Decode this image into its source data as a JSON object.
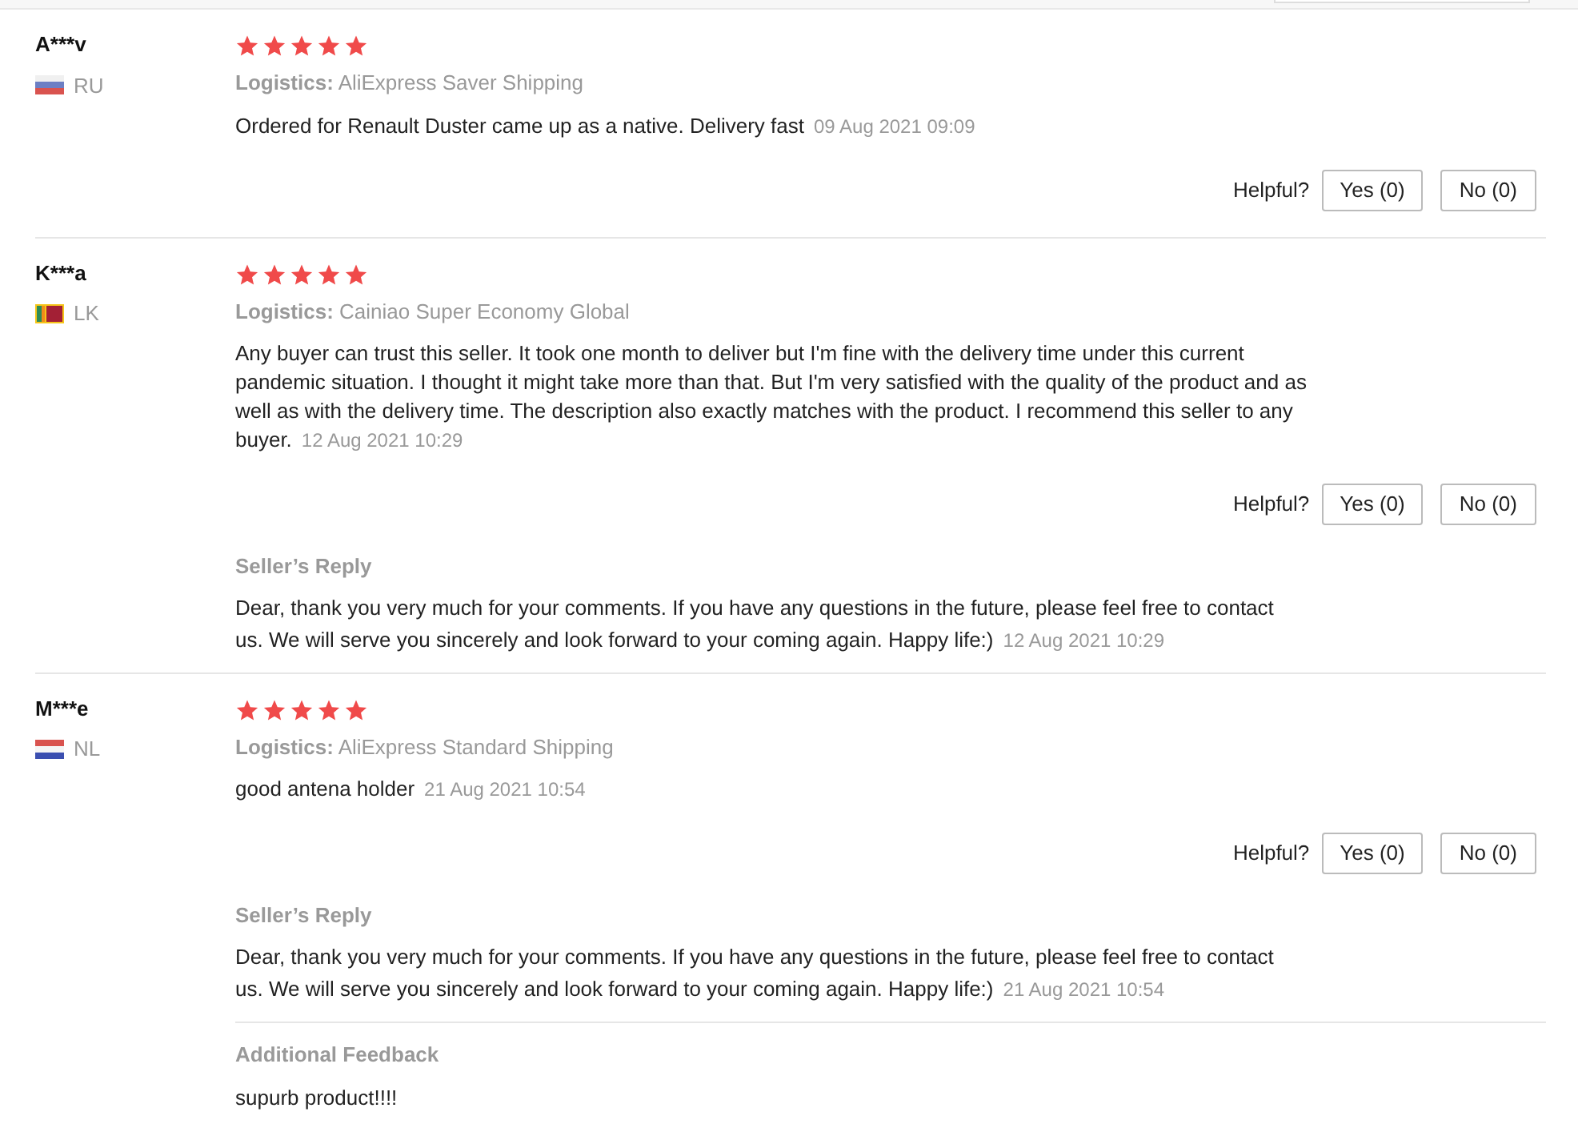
{
  "reviews": [
    {
      "name": "A***v",
      "country": "RU",
      "kind": "ru",
      "stars": 5,
      "logistics_label": "Logistics:",
      "logistics": "AliExpress Saver Shipping",
      "text": "Ordered for Renault Duster came up as a native. Delivery fast",
      "date": "09 Aug 2021 09:09",
      "helpful_label": "Helpful?",
      "yes": "Yes (0)",
      "no": "No (0)"
    },
    {
      "name": "K***a",
      "country": "LK",
      "kind": "lk",
      "stars": 5,
      "logistics_label": "Logistics:",
      "logistics": "Cainiao Super Economy Global",
      "text": "Any buyer can trust this seller. It took one month to deliver but I'm fine with the delivery time under this current pandemic situation. I thought it might take more than that. But I'm very satisfied with the quality of the product and as well as with the delivery time. The description also exactly matches with the product. I recommend this seller to any buyer.",
      "date": "12 Aug 2021 10:29",
      "helpful_label": "Helpful?",
      "yes": "Yes (0)",
      "no": "No (0)",
      "reply": {
        "title": "Seller’s Reply",
        "text": "Dear, thank you very much for your comments. If you have any questions in the future, please feel free to contact us. We will serve you sincerely and look forward to your coming again. Happy life:)",
        "date": "12 Aug 2021 10:29"
      }
    },
    {
      "name": "M***e",
      "country": "NL",
      "kind": "nl",
      "stars": 5,
      "logistics_label": "Logistics:",
      "logistics": "AliExpress Standard Shipping",
      "text": "good antena holder",
      "date": "21 Aug 2021 10:54",
      "helpful_label": "Helpful?",
      "yes": "Yes (0)",
      "no": "No (0)",
      "reply": {
        "title": "Seller’s Reply",
        "text": "Dear, thank you very much for your comments. If you have any questions in the future, please feel free to contact us. We will serve you sincerely and look forward to your coming again. Happy life:)",
        "date": "21 Aug 2021 10:54"
      },
      "additional": {
        "title": "Additional Feedback",
        "text": "supurb product!!!!"
      }
    }
  ]
}
